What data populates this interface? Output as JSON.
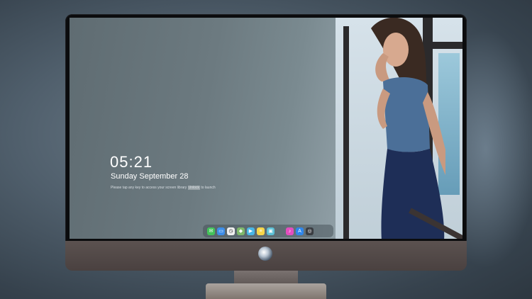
{
  "lockscreen": {
    "time": "05:21",
    "date": "Sunday September  28",
    "notice_prefix": "Please tap any key to access your screen library",
    "notice_highlight": "Unlock",
    "notice_suffix": "to launch"
  },
  "dock": {
    "items": [
      {
        "name": "messages",
        "color": "#44c35a",
        "glyph": "✉"
      },
      {
        "name": "files",
        "color": "#3d8ee8",
        "glyph": "▭"
      },
      {
        "name": "clock",
        "color": "#f0f0f0",
        "glyph": "◷"
      },
      {
        "name": "maps",
        "color": "#7fb86b",
        "glyph": "◆"
      },
      {
        "name": "video",
        "color": "#49b6e6",
        "glyph": "▶"
      },
      {
        "name": "notes",
        "color": "#f6d64a",
        "glyph": "≡"
      },
      {
        "name": "photos",
        "color": "#5bc0d6",
        "glyph": "▣"
      },
      {
        "name": "music",
        "color": "#e34ebf",
        "glyph": "♪"
      },
      {
        "name": "app-store",
        "color": "#2f86ea",
        "glyph": "A"
      },
      {
        "name": "camera",
        "color": "#3a3d42",
        "glyph": "◎"
      }
    ]
  }
}
